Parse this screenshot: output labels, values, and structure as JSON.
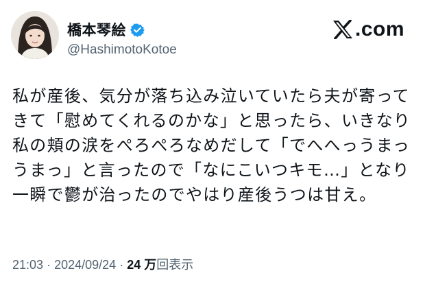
{
  "author": {
    "display_name": "橋本琴絵",
    "handle": "@HashimotoKotoe",
    "verified": true
  },
  "brand": {
    "logo_icon": "x-logo-icon",
    "text": ".com"
  },
  "tweet": {
    "lines": [
      "私が産後、気分が落ち込み泣いていたら夫が寄って",
      "きて「慰めてくれるのかな」と思ったら、いきなり",
      "私の頬の涙をぺろぺろなめだして「でへへっうまっ",
      "うまっ」と言ったので「なにこいつキモ…」となり",
      "一瞬で鬱が治ったのでやはり産後うつは甘え。"
    ]
  },
  "meta": {
    "time": "21:03",
    "separator": "·",
    "date": "2024/09/24",
    "views_count": "24 万",
    "views_label": "回表示"
  },
  "colors": {
    "text": "#0f1419",
    "muted": "#536471",
    "verified_badge": "#1d9bf0"
  }
}
